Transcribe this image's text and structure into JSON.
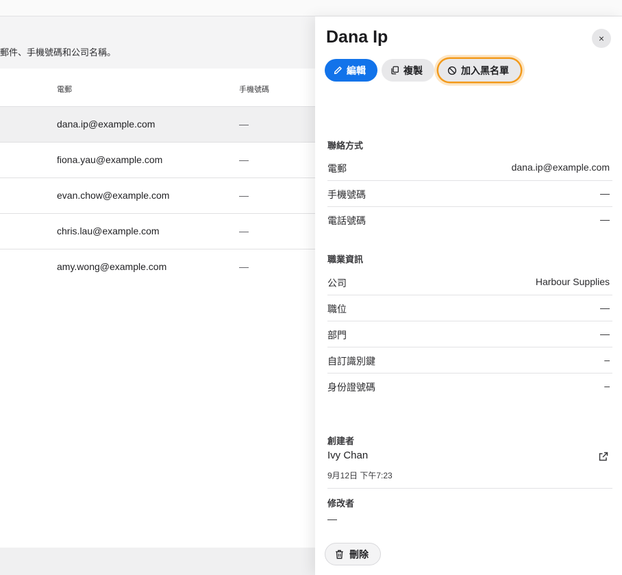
{
  "list": {
    "search_hint": "郵件、手機號碼和公司名稱。",
    "columns": {
      "email": "電郵",
      "mobile": "手機號碼"
    },
    "rows": [
      {
        "email": "dana.ip@example.com",
        "mobile": "—"
      },
      {
        "email": "fiona.yau@example.com",
        "mobile": "—"
      },
      {
        "email": "evan.chow@example.com",
        "mobile": "—"
      },
      {
        "email": "chris.lau@example.com",
        "mobile": "—"
      },
      {
        "email": "amy.wong@example.com",
        "mobile": "—"
      }
    ]
  },
  "panel": {
    "title": "Dana Ip",
    "close_label": "×",
    "actions": {
      "edit": "編輯",
      "copy": "複製",
      "block": "加入黑名單",
      "delete": "刪除"
    },
    "contact": {
      "heading": "聯絡方式",
      "email_label": "電郵",
      "email_value": "dana.ip@example.com",
      "mobile_label": "手機號碼",
      "mobile_value": "—",
      "phone_label": "電話號碼",
      "phone_value": "—"
    },
    "job": {
      "heading": "職業資訊",
      "company_label": "公司",
      "company_value": "Harbour Supplies",
      "position_label": "職位",
      "position_value": "—",
      "department_label": "部門",
      "department_value": "—",
      "custom_id_label": "自訂識別鍵",
      "custom_id_value": "–",
      "id_number_label": "身份證號碼",
      "id_number_value": "–"
    },
    "creator": {
      "heading": "創建者",
      "name": "Ivy Chan",
      "date": "9月12日 下午7:23"
    },
    "modifier": {
      "heading": "修改者",
      "value": "—"
    }
  },
  "icons": [
    "pencil-icon",
    "copy-icon",
    "block-icon",
    "external-link-icon",
    "trash-icon",
    "close-icon"
  ],
  "colors": {
    "primary": "#1273ea",
    "focus_ring": "#f29a1c"
  }
}
